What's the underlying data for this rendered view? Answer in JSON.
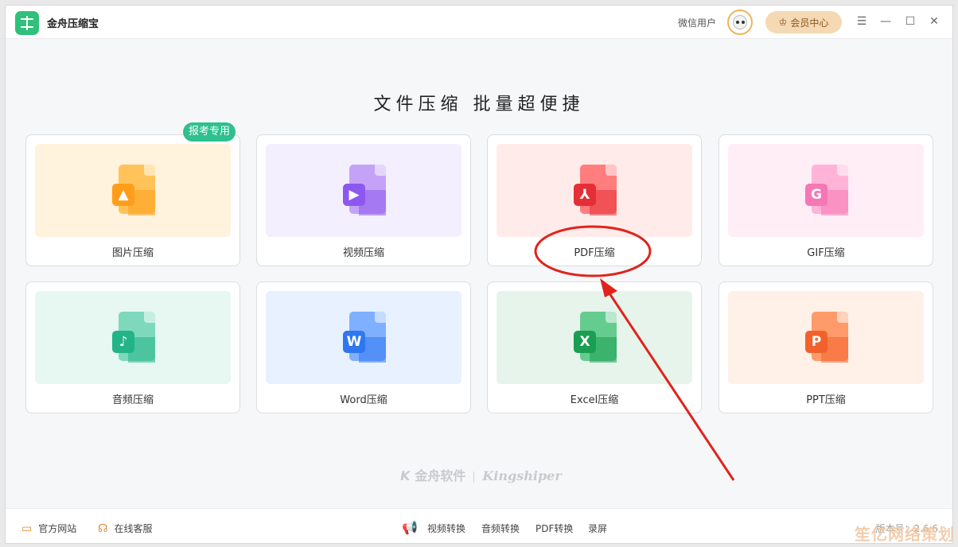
{
  "app": {
    "title": "金舟压缩宝"
  },
  "header": {
    "user_name": "微信用户",
    "vip_label": "会员中心"
  },
  "window_controls": {
    "menu": "☰",
    "minimize": "—",
    "maximize": "☐",
    "close": "✕"
  },
  "main": {
    "headline": "文件压缩  批量超便捷",
    "badge_text": "报考专用",
    "cards": [
      {
        "label": "图片压缩",
        "icon": "image-file-icon",
        "panel_color": "#fff3de",
        "doc_color": "#ffc35a",
        "badge_color": "#ff9d1a",
        "badge_glyph": "▲"
      },
      {
        "label": "视频压缩",
        "icon": "video-file-icon",
        "panel_color": "#f3efff",
        "doc_color": "#c4a3f7",
        "badge_color": "#8d58ef",
        "badge_glyph": "▶"
      },
      {
        "label": "PDF压缩",
        "icon": "pdf-file-icon",
        "panel_color": "#ffecea",
        "doc_color": "#ff7d7d",
        "badge_color": "#e52f36",
        "badge_glyph": "⅄"
      },
      {
        "label": "GIF压缩",
        "icon": "gif-file-icon",
        "panel_color": "#ffeef6",
        "doc_color": "#ffb3d7",
        "badge_color": "#f577b4",
        "badge_glyph": "G"
      },
      {
        "label": "音频压缩",
        "icon": "audio-file-icon",
        "panel_color": "#e7f7f2",
        "doc_color": "#7ed9bc",
        "badge_color": "#22b487",
        "badge_glyph": "♪"
      },
      {
        "label": "Word压缩",
        "icon": "word-file-icon",
        "panel_color": "#e8f1ff",
        "doc_color": "#7fb0ff",
        "badge_color": "#2f77f1",
        "badge_glyph": "W"
      },
      {
        "label": "Excel压缩",
        "icon": "excel-file-icon",
        "panel_color": "#e6f4ec",
        "doc_color": "#65cc8f",
        "badge_color": "#1a9e52",
        "badge_glyph": "X"
      },
      {
        "label": "PPT压缩",
        "icon": "ppt-file-icon",
        "panel_color": "#fff0e8",
        "doc_color": "#ff9b6a",
        "badge_color": "#f2612b",
        "badge_glyph": "P"
      }
    ]
  },
  "watermark": {
    "brand_cn": "金舟软件",
    "brand_en": "Kingshiper"
  },
  "footer": {
    "official_site": "官方网站",
    "online_service": "在线客服",
    "links": [
      "视频转换",
      "音频转换",
      "PDF转换",
      "录屏"
    ],
    "version": "版本号：2.6.6"
  },
  "corner_watermark": "笙亿网络策划",
  "colors": {
    "accent_green": "#2ec08e",
    "annotation_red": "#e0231b",
    "vip_bg": "#f5d9b4"
  }
}
